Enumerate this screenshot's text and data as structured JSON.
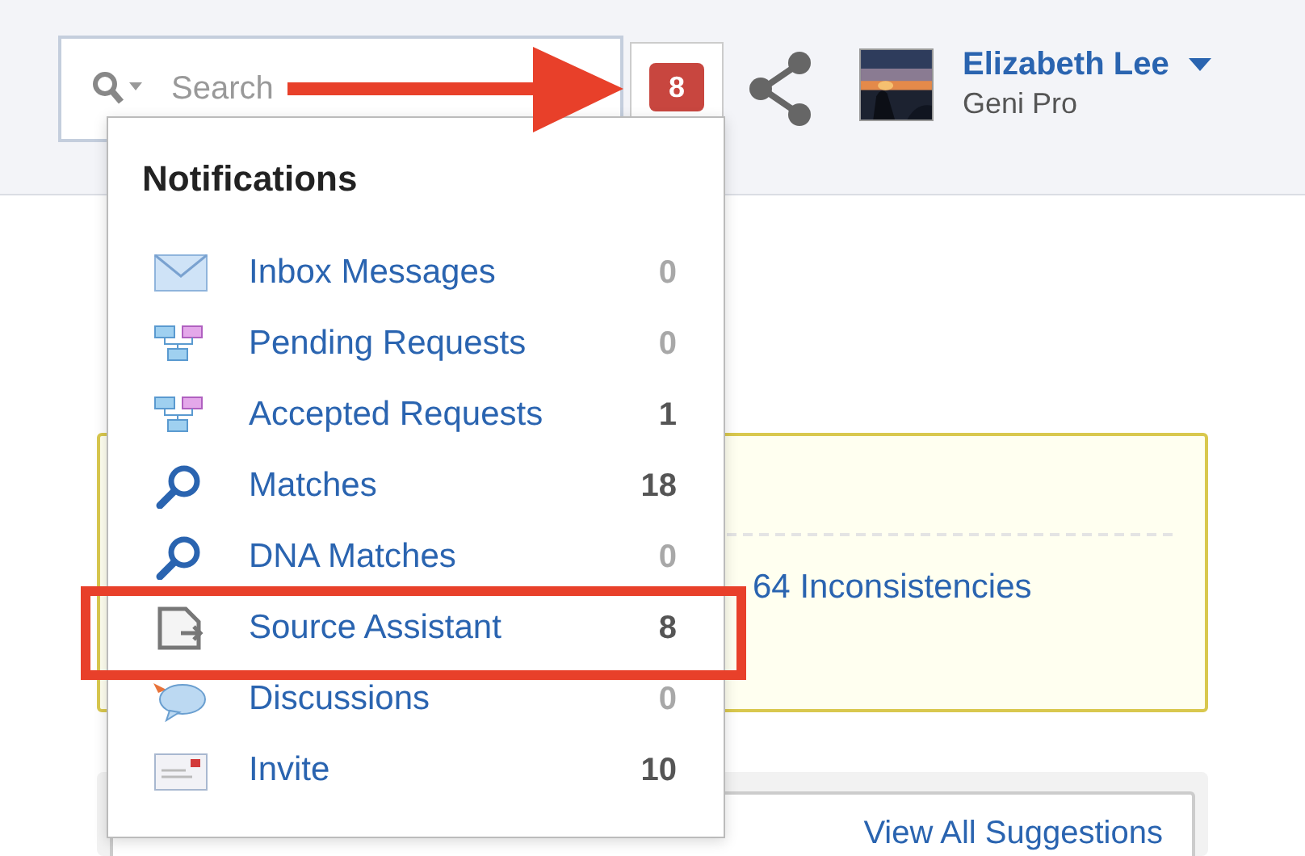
{
  "search": {
    "placeholder": "Search"
  },
  "notification_badge": "8",
  "user": {
    "name": "Elizabeth Lee",
    "plan": "Geni Pro"
  },
  "notifications": {
    "title": "Notifications",
    "items": [
      {
        "kind": "inbox",
        "label": "Inbox Messages",
        "count": "0",
        "muted": true,
        "highlighted": false
      },
      {
        "kind": "tree",
        "label": "Pending Requests",
        "count": "0",
        "muted": true,
        "highlighted": false
      },
      {
        "kind": "tree",
        "label": "Accepted Requests",
        "count": "1",
        "muted": false,
        "highlighted": false
      },
      {
        "kind": "search",
        "label": "Matches",
        "count": "18",
        "muted": false,
        "highlighted": false
      },
      {
        "kind": "search",
        "label": "DNA Matches",
        "count": "0",
        "muted": true,
        "highlighted": false
      },
      {
        "kind": "source",
        "label": "Source Assistant",
        "count": "8",
        "muted": false,
        "highlighted": true
      },
      {
        "kind": "discussion",
        "label": "Discussions",
        "count": "0",
        "muted": true,
        "highlighted": false
      },
      {
        "kind": "invite",
        "label": "Invite",
        "count": "10",
        "muted": false,
        "highlighted": false
      }
    ]
  },
  "alert_box": {
    "link": "64 Inconsistencies"
  },
  "source_assistant_card": {
    "link": "View All Suggestions"
  },
  "annotations": [
    {
      "kind": "arrow"
    }
  ]
}
